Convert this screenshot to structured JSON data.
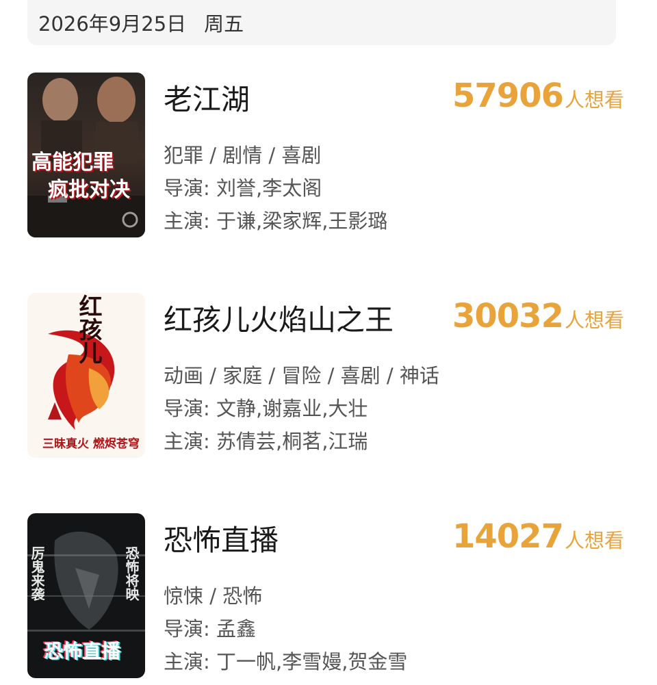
{
  "header": {
    "date": "2026年9月25日",
    "weekday": "周五"
  },
  "movies": [
    {
      "title": "老江湖",
      "want_count": "57906",
      "want_unit": "人想看",
      "genre": "犯罪 / 剧情 / 喜剧",
      "director": "导演: 刘誉,李太阁",
      "cast": "主演: 于谦,梁家辉,王影璐",
      "poster_text": [
        "高能犯罪",
        "疯批对决"
      ]
    },
    {
      "title": "红孩儿火焰山之王",
      "want_count": "30032",
      "want_unit": "人想看",
      "genre": "动画 / 家庭 / 冒险 / 喜剧 / 神话",
      "director": "导演: 文静,谢嘉业,大壮",
      "cast": "主演: 苏倩芸,桐茗,江瑞",
      "poster_text": [
        "红孩儿",
        "三昧真火 燃烬苍穹"
      ]
    },
    {
      "title": "恐怖直播",
      "want_count": "14027",
      "want_unit": "人想看",
      "genre": "惊悚 / 恐怖",
      "director": "导演: 孟鑫",
      "cast": "主演: 丁一帆,李雪嫚,贺金雪",
      "poster_text": [
        "厉鬼来袭",
        "恐怖将映",
        "恐怖直播"
      ]
    }
  ],
  "colors": {
    "accent": "#e8a33b",
    "title": "#1a1a1a",
    "info": "#555555",
    "date_bg": "#f5f5f5"
  }
}
